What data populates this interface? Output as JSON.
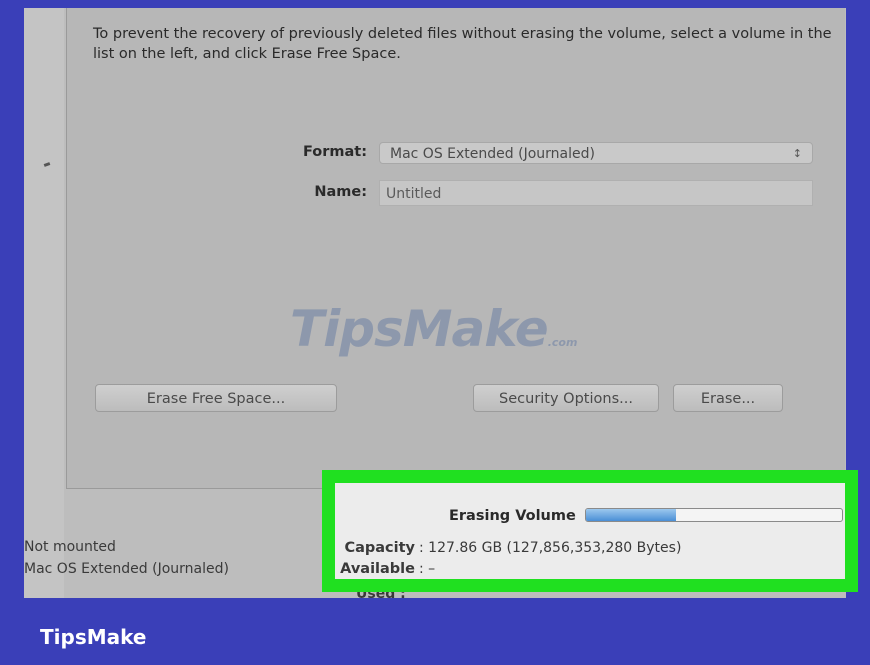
{
  "instructions": "To prevent the recovery of previously deleted files without erasing the volume, select a volume in the list on the left, and click Erase Free Space.",
  "form": {
    "format_label": "Format:",
    "format_value": "Mac OS Extended (Journaled)",
    "name_label": "Name:",
    "name_value": "Untitled"
  },
  "buttons": {
    "erase_free_space": "Erase Free Space...",
    "security_options": "Security Options...",
    "erase": "Erase..."
  },
  "watermark": {
    "text": "TipsMake",
    "suffix": ".com"
  },
  "volume_info": {
    "status": "Not mounted",
    "format": "Mac OS Extended (Journaled)",
    "erasing_label": "Erasing Volume",
    "progress": 0.35,
    "capacity_label": "Capacity",
    "capacity_value": ": 127.86 GB (127,856,353,280 Bytes)",
    "available_label": "Available",
    "available_value": ": –",
    "used_label": "Used :"
  },
  "brand": "TipsMake",
  "colors": {
    "background": "#3a3fb8",
    "highlight": "#20e020",
    "progress": "#4a8fd6"
  }
}
